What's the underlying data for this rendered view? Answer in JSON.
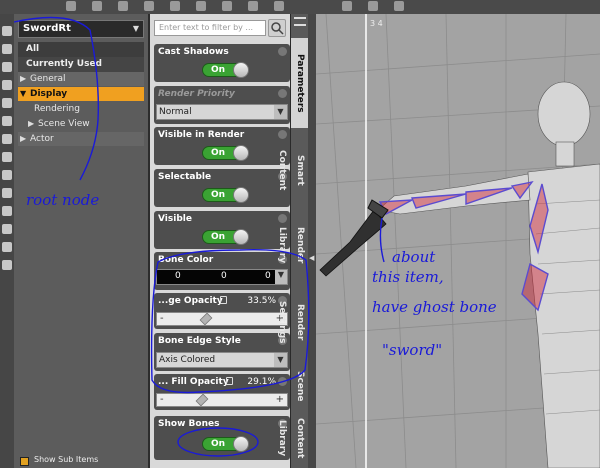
{
  "node_pane": {
    "selected_node": "SwordRt",
    "groups": [
      "All",
      "Currently Used"
    ],
    "tree": [
      {
        "label": "General",
        "expanded": false,
        "indent": 0
      },
      {
        "label": "Display",
        "expanded": true,
        "indent": 0,
        "selected": true
      },
      {
        "label": "Rendering",
        "expanded": false,
        "indent": 1,
        "leaf": true
      },
      {
        "label": "Scene View",
        "expanded": false,
        "indent": 1
      },
      {
        "label": "Actor",
        "expanded": false,
        "indent": 0
      }
    ],
    "show_sub_items": "Show Sub Items"
  },
  "filter": {
    "placeholder": "Enter text to filter by ..."
  },
  "properties": {
    "cast_shadows": {
      "label": "Cast Shadows",
      "value": "On"
    },
    "render_priority": {
      "label": "Render Priority",
      "value": "Normal"
    },
    "visible_in_render": {
      "label": "Visible in Render",
      "value": "On"
    },
    "selectable": {
      "label": "Selectable",
      "value": "On"
    },
    "visible": {
      "label": "Visible",
      "value": "On"
    },
    "bone_color": {
      "label": "Bone Color",
      "r": "0",
      "g": "0",
      "b": "0"
    },
    "edge_opacity": {
      "label": "...ge Opacity",
      "value": "33.5%",
      "fraction": 0.335
    },
    "bone_edge_style": {
      "label": "Bone Edge Style",
      "value": "Axis Colored"
    },
    "fill_opacity": {
      "label": "... Fill Opacity",
      "value": "29.1%",
      "fraction": 0.291
    },
    "show_bones": {
      "label": "Show Bones",
      "value": "On"
    }
  },
  "tabs": [
    "Parameters",
    "Smart Content",
    "Render Library",
    "Render Settings",
    "Scene",
    "Content Library"
  ],
  "viewport": {
    "corner_label": "3 4"
  },
  "annotations": {
    "root_node": "root node",
    "note_lines": [
      "about",
      "this item,",
      "have ghost bone",
      "\"sword\""
    ]
  },
  "colors": {
    "toggle_on": "#3aa333",
    "selected_row": "#f0a020",
    "annotation_ink": "#1a1ad8",
    "bone_red": "#d02030"
  }
}
